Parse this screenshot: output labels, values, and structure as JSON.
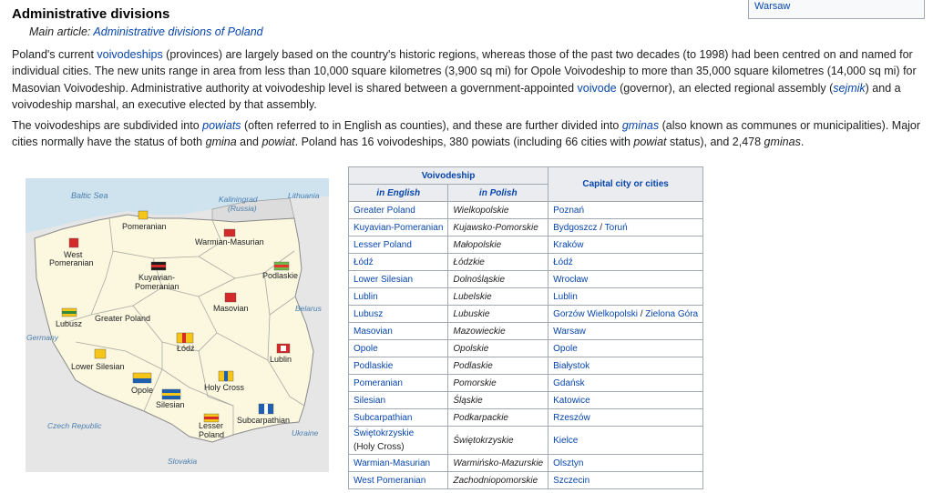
{
  "infobox": {
    "city": "Warsaw"
  },
  "section": {
    "title": "Administrative divisions"
  },
  "hatnote": {
    "prefix": "Main article: ",
    "link": "Administrative divisions of Poland"
  },
  "p1": {
    "t1": "Poland's current ",
    "l1": "voivodeships",
    "t2": " (provinces) are largely based on the country's historic regions, whereas those of the past two decades (to 1998) had been centred on and named for individual cities. The new units range in area from less than 10,000 square kilometres (3,900 sq mi) for Opole Voivodeship to more than 35,000 square kilometres (14,000 sq mi) for Masovian Voivodeship. Administrative authority at voivodeship level is shared between a government-appointed ",
    "l2": "voivode",
    "t3": " (governor), an elected regional assembly (",
    "l3": "sejmik",
    "t4": ") and a voivodeship marshal, an executive elected by that assembly."
  },
  "p2": {
    "t1": "The voivodeships are subdivided into ",
    "l1": "powiats",
    "t2": " (often referred to in English as counties), and these are further divided into ",
    "l2": "gminas",
    "t3": " (also known as communes or municipalities). Major cities normally have the status of both ",
    "i1": "gmina",
    "t4": " and ",
    "i2": "powiat",
    "t5": ". Poland has 16 voivodeships, 380 powiats (including 66 cities with ",
    "i3": "powiat",
    "t6": " status), and 2,478 ",
    "i4": "gminas",
    "t7": "."
  },
  "map": {
    "colors": {
      "sea": "#cfe3ef",
      "land": "#fbf8df",
      "neighbor": "#e6e6e6",
      "border": "#8a8a8a",
      "water_text": "#4a7fb0"
    },
    "labels": {
      "baltic": "Baltic Sea",
      "kaliningrad1": "Kaliningrad",
      "kaliningrad2": "(Russia)",
      "lithuania": "Lithuania",
      "belarus": "Belarus",
      "ukraine": "Ukraine",
      "germany": "Germany",
      "czech": "Czech Republic",
      "slovakia": "Slovakia",
      "pomeranian": "Pomeranian",
      "warmian": "Warmian-Masurian",
      "west1": "West",
      "west2": "Pomeranian",
      "kuyavian1": "Kuyavian-",
      "kuyavian2": "Pomeranian",
      "podlaskie": "Podlaskie",
      "lubusz": "Lubusz",
      "greater": "Greater Poland",
      "masovian": "Masovian",
      "lodz": "Łódź",
      "lublin": "Lublin",
      "lower": "Lower Silesian",
      "opole": "Opole",
      "silesian": "Silesian",
      "holy": "Holy Cross",
      "lesser1": "Lesser",
      "lesser2": "Poland",
      "subcarp": "Subcarpathian"
    }
  },
  "table": {
    "header_group": "Voivodeship",
    "header_en": "in English",
    "header_pl": "in Polish",
    "header_cap": "Capital city or cities",
    "rows": [
      {
        "en": "Greater Poland",
        "pl": "Wielkopolskie",
        "cap": "Poznań"
      },
      {
        "en": "Kuyavian-Pomeranian",
        "pl": "Kujawsko-Pomorskie",
        "cap": "Bydgoszcz",
        "sep": " / ",
        "cap2": "Toruń"
      },
      {
        "en": "Lesser Poland",
        "pl": "Małopolskie",
        "cap": "Kraków"
      },
      {
        "en": "Łódź",
        "pl": "Łódzkie",
        "cap": "Łódź"
      },
      {
        "en": "Lower Silesian",
        "pl": "Dolnośląskie",
        "cap": "Wrocław"
      },
      {
        "en": "Lublin",
        "pl": "Lubelskie",
        "cap": "Lublin"
      },
      {
        "en": "Lubusz",
        "pl": "Lubuskie",
        "cap": "Gorzów Wielkopolski",
        "sep": " / ",
        "cap2": "Zielona Góra"
      },
      {
        "en": "Masovian",
        "pl": "Mazowieckie",
        "cap": "Warsaw"
      },
      {
        "en": "Opole",
        "pl": "Opolskie",
        "cap": "Opole"
      },
      {
        "en": "Podlaskie",
        "pl": "Podlaskie",
        "cap": "Białystok"
      },
      {
        "en": "Pomeranian",
        "pl": "Pomorskie",
        "cap": "Gdańsk"
      },
      {
        "en": "Silesian",
        "pl": "Śląskie",
        "cap": "Katowice"
      },
      {
        "en": "Subcarpathian",
        "pl": "Podkarpackie",
        "cap": "Rzeszów"
      },
      {
        "en": "Świętokrzyskie",
        "en2": "(Holy Cross)",
        "pl": "Świętokrzyskie",
        "cap": "Kielce"
      },
      {
        "en": "Warmian-Masurian",
        "pl": "Warmińsko-Mazurskie",
        "cap": "Olsztyn"
      },
      {
        "en": "West Pomeranian",
        "pl": "Zachodniopomorskie",
        "cap": "Szczecin"
      }
    ]
  }
}
